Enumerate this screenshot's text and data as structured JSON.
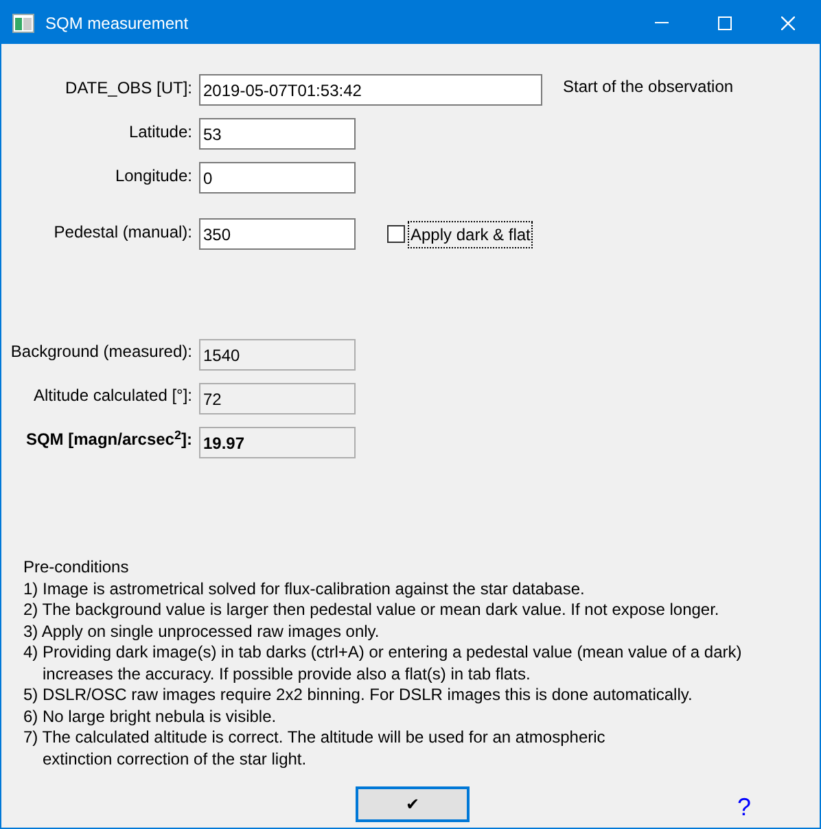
{
  "window": {
    "title": "SQM measurement"
  },
  "inputs": [
    {
      "label": "DATE_OBS [UT]:",
      "value": "2019-05-07T01:53:42",
      "kind": "wide",
      "note": "Start of the observation"
    },
    {
      "label": "Latitude:",
      "value": "53",
      "kind": "short"
    },
    {
      "label": "Longitude:",
      "value": "0",
      "kind": "short"
    }
  ],
  "pedestal": {
    "label": "Pedestal (manual):",
    "value": "350",
    "checkbox": {
      "label": "Apply dark & flat",
      "checked": false
    }
  },
  "results": [
    {
      "label": "Background (measured):",
      "value": "1540",
      "bold": false
    },
    {
      "label": "Altitude calculated [°]:",
      "value": "72",
      "bold": false
    },
    {
      "label": "SQM [magn/arcsec$^{2}$]:",
      "value": "19.97",
      "bold": true
    }
  ],
  "preconditions": [
    {
      "text": "Pre-conditions",
      "kind": "line"
    },
    {
      "text": "1) Image is astrometrical solved for flux-calibration against the star database.",
      "kind": "line"
    },
    {
      "text": "2) The background value is larger then pedestal value or mean dark value. If not expose longer.",
      "kind": "line"
    },
    {
      "text": "3) Apply on single unprocessed raw images only.",
      "kind": "line"
    },
    {
      "text": "4) Providing dark image(s) in tab darks (ctrl+A) or entering a pedestal value  (mean value of a dark)",
      "kind": "line"
    },
    {
      "text": "increases the accuracy. If possible provide also a flat(s) in tab flats.",
      "kind": "continuation"
    },
    {
      "text": "5) DSLR/OSC raw images require 2x2 binning. For DSLR images this is done automatically.",
      "kind": "line"
    },
    {
      "text": "6) No large bright nebula is visible.",
      "kind": "line"
    },
    {
      "text": "7) The calculated altitude is correct. The altitude will be used for an atmospheric",
      "kind": "line"
    },
    {
      "text": "extinction correction of the star light.",
      "kind": "continuation"
    }
  ],
  "ok_button": {
    "label": "✔"
  },
  "help": {
    "label": "?"
  }
}
